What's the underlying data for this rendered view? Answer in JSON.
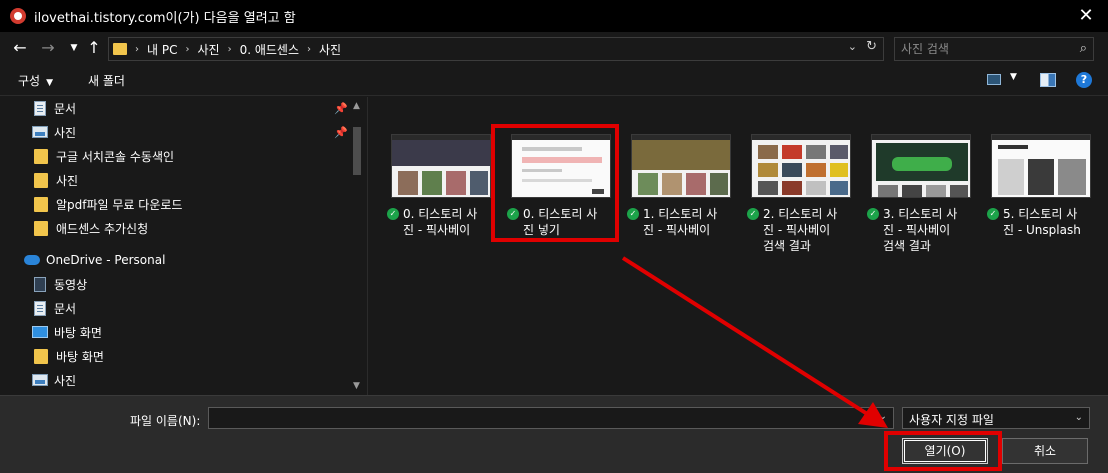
{
  "window": {
    "title": "ilovethai.tistory.com이(가) 다음을 열려고 함"
  },
  "address": {
    "crumbs": [
      "내 PC",
      "사진",
      "0. 애드센스",
      "사진"
    ],
    "search_placeholder": "사진 검색"
  },
  "toolbar": {
    "organize": "구성",
    "new_folder": "새 폴더"
  },
  "nav": {
    "items": [
      {
        "label": "문서",
        "icon": "document-icon",
        "pinned": true
      },
      {
        "label": "사진",
        "icon": "pictures-icon",
        "pinned": true
      },
      {
        "label": "구글 서치콘솔 수동색인",
        "icon": "folder-icon"
      },
      {
        "label": "사진",
        "icon": "folder-icon"
      },
      {
        "label": "알pdf파일 무료 다운로드",
        "icon": "folder-icon"
      },
      {
        "label": "애드센스 추가신청",
        "icon": "folder-icon"
      },
      {
        "label": "OneDrive - Personal",
        "icon": "cloud-icon"
      },
      {
        "label": "동영상",
        "icon": "video-icon"
      },
      {
        "label": "문서",
        "icon": "document-icon"
      },
      {
        "label": "바탕 화면",
        "icon": "desktop-icon"
      },
      {
        "label": "바탕 화면",
        "icon": "folder-icon"
      },
      {
        "label": "사진",
        "icon": "pictures-icon"
      }
    ]
  },
  "files": [
    {
      "line1": "0. 티스토리 사",
      "line2": "진 - 픽사베이",
      "line3": ""
    },
    {
      "line1": "0. 티스토리 사",
      "line2": "진 넣기",
      "line3": "",
      "selected": true
    },
    {
      "line1": "1. 티스토리 사",
      "line2": "진 - 픽사베이",
      "line3": ""
    },
    {
      "line1": "2. 티스토리 사",
      "line2": "진 - 픽사베이",
      "line3": "검색 결과"
    },
    {
      "line1": "3. 티스토리 사",
      "line2": "진 - 픽사베이",
      "line3": "검색 결과"
    },
    {
      "line1": "5. 티스토리 사",
      "line2": "진 - Unsplash",
      "line3": ""
    }
  ],
  "bottom": {
    "filename_label": "파일 이름(N):",
    "filename_value": "",
    "filetype": "사용자 지정 파일",
    "open_label": "열기(O)",
    "cancel_label": "취소"
  },
  "colors": {
    "annotation": "#e00000",
    "check": "#1ca34a",
    "folder": "#f1c54c"
  }
}
